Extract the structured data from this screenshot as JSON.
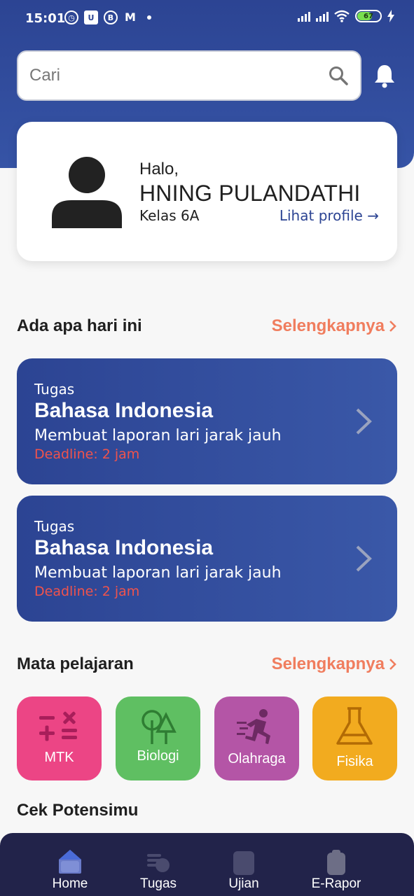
{
  "status_bar": {
    "time": "15:01",
    "notif_icons": [
      "alarm-icon",
      "u-app-icon",
      "b-app-icon",
      "gmail-icon"
    ],
    "battery_level": "67"
  },
  "search": {
    "placeholder": "Cari"
  },
  "profile": {
    "greeting": "Halo,",
    "name": "HNING PULANDATHI",
    "class": "Kelas 6A",
    "link": "Lihat profile"
  },
  "today": {
    "title": "Ada apa hari ini",
    "more": "Selengkapnya",
    "tasks": [
      {
        "type": "Tugas",
        "subject": "Bahasa Indonesia",
        "description": "Membuat laporan lari jarak jauh",
        "deadline": "Deadline: 2 jam"
      },
      {
        "type": "Tugas",
        "subject": "Bahasa Indonesia",
        "description": "Membuat laporan lari jarak jauh",
        "deadline": "Deadline: 2 jam"
      }
    ]
  },
  "subjects": {
    "title": "Mata pelajaran",
    "more": "Selengkapnya",
    "items": [
      {
        "label": "MTK",
        "color": "#ec4585",
        "icon": "math-operators-icon"
      },
      {
        "label": "Biologi",
        "color": "#5fbf62",
        "icon": "trees-icon"
      },
      {
        "label": "Olahraga",
        "color": "#b455a6",
        "icon": "running-person-icon"
      },
      {
        "label": "Fisika",
        "color": "#f2ab1f",
        "icon": "flask-icon"
      }
    ]
  },
  "potential": {
    "title": "Cek Potensimu"
  },
  "bottom_nav": {
    "items": [
      {
        "label": "Home",
        "icon": "home-icon",
        "active": true
      },
      {
        "label": "Tugas",
        "icon": "tasks-icon",
        "active": false
      },
      {
        "label": "Ujian",
        "icon": "exam-icon",
        "active": false
      },
      {
        "label": "E-Rapor",
        "icon": "report-icon",
        "active": false
      }
    ]
  },
  "colors": {
    "primary": "#2c4493",
    "accent": "#f07d5e",
    "deadline": "#f0534c",
    "nav_bg": "#22234a"
  }
}
